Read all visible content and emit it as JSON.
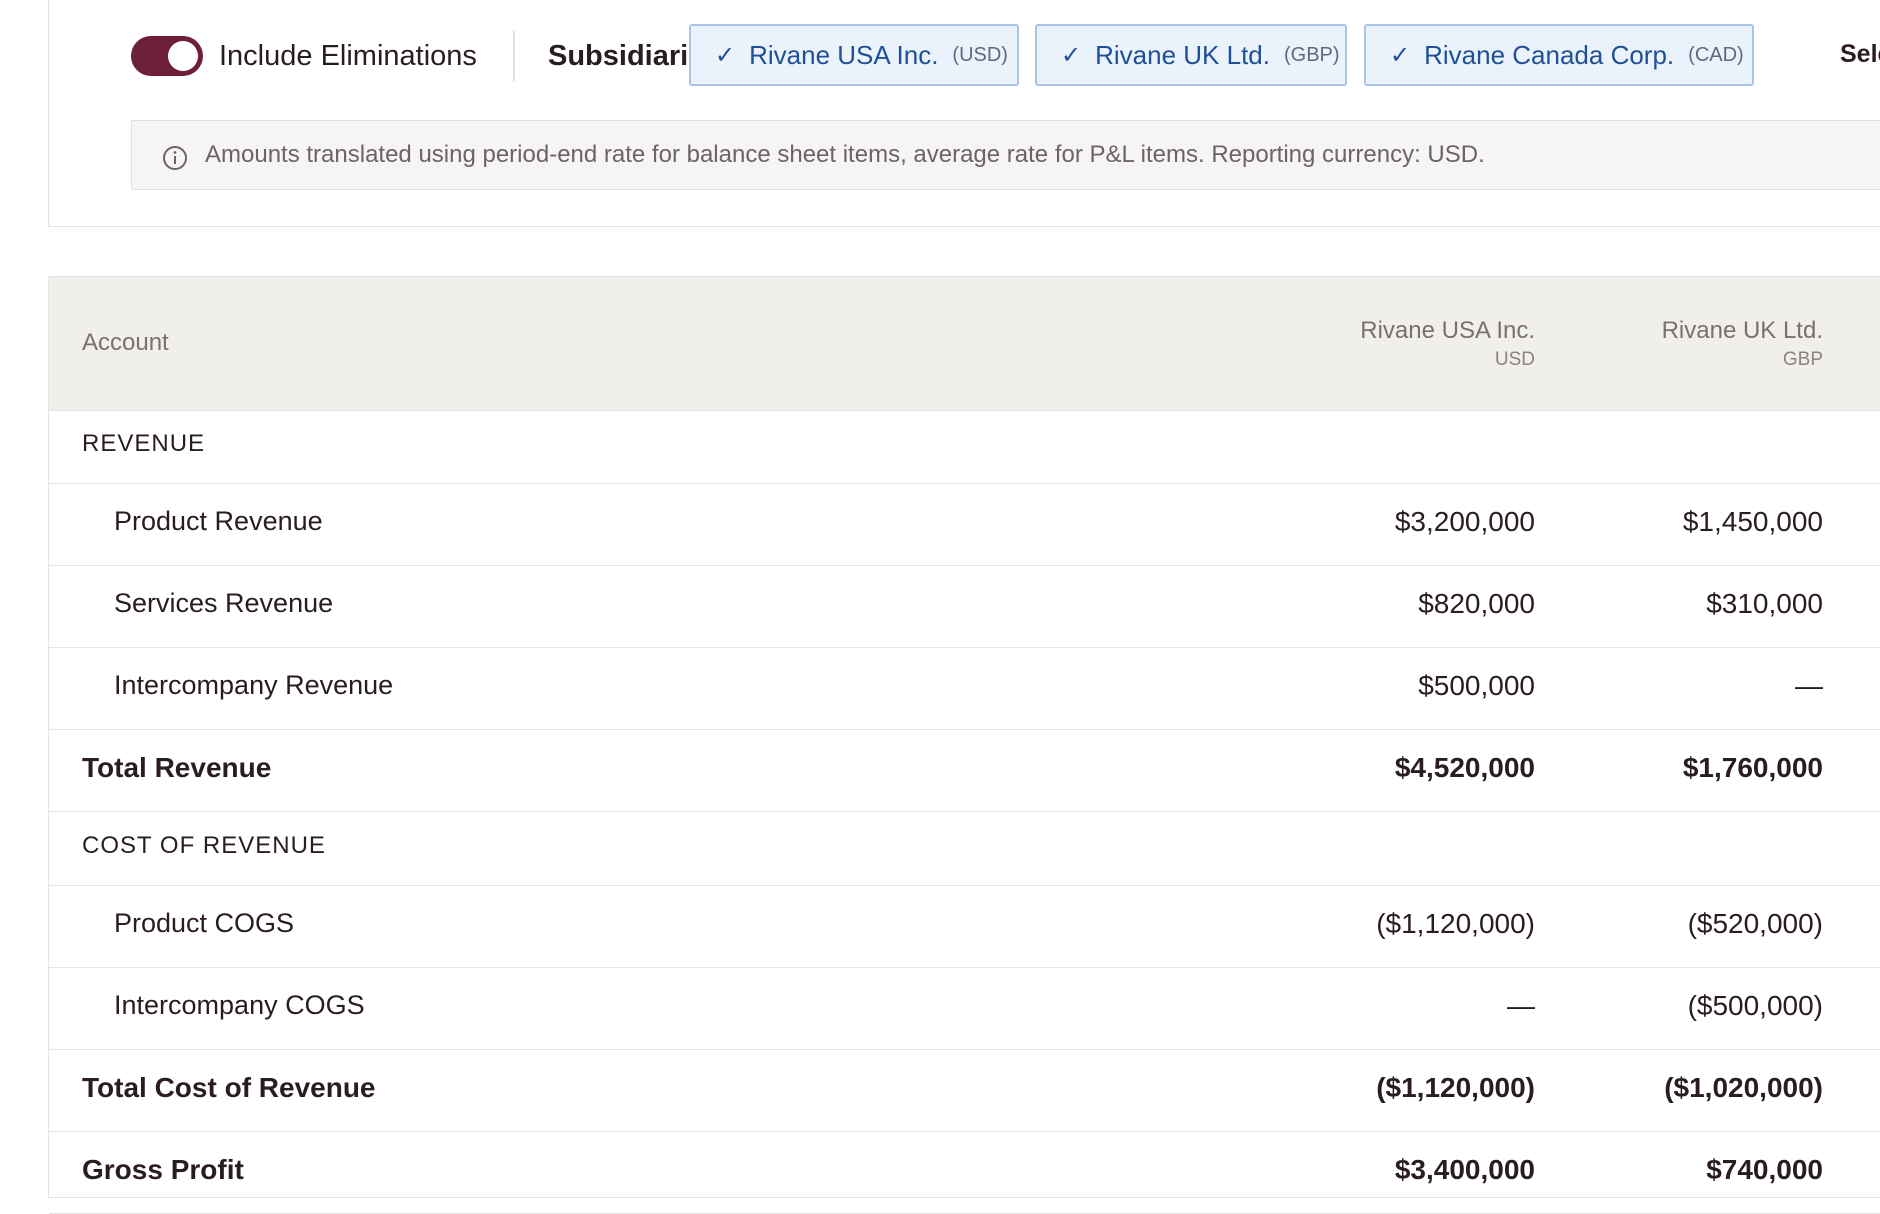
{
  "filters": {
    "include_eliminations_label": "Include Eliminations",
    "include_eliminations_on": true,
    "subsidiaries_label": "Subsidiaries:",
    "chips": [
      {
        "name": "Rivane USA Inc.",
        "currency": "(USD)",
        "selected": true
      },
      {
        "name": "Rivane UK Ltd.",
        "currency": "(GBP)",
        "selected": true
      },
      {
        "name": "Rivane Canada Corp.",
        "currency": "(CAD)",
        "selected": true
      }
    ],
    "select_all_label": "Select A",
    "check_glyph": "✓",
    "info_text": "Amounts translated using period-end rate for balance sheet items, average rate for P&L items. Reporting currency: USD."
  },
  "table": {
    "header": {
      "account": "Account",
      "columns": [
        {
          "name": "Rivane USA Inc.",
          "currency": "USD"
        },
        {
          "name": "Rivane UK Ltd.",
          "currency": "GBP"
        }
      ]
    },
    "rows": [
      {
        "type": "section",
        "label": "REVENUE",
        "values": [
          "",
          ""
        ]
      },
      {
        "type": "line",
        "label": "Product Revenue",
        "values": [
          "$3,200,000",
          "$1,450,000"
        ]
      },
      {
        "type": "line",
        "label": "Services Revenue",
        "values": [
          "$820,000",
          "$310,000"
        ]
      },
      {
        "type": "line",
        "label": "Intercompany Revenue",
        "values": [
          "$500,000",
          "—"
        ]
      },
      {
        "type": "total",
        "label": "Total Revenue",
        "values": [
          "$4,520,000",
          "$1,760,000"
        ]
      },
      {
        "type": "section",
        "label": "COST OF REVENUE",
        "values": [
          "",
          ""
        ]
      },
      {
        "type": "line",
        "label": "Product COGS",
        "values": [
          "($1,120,000)",
          "($520,000)"
        ]
      },
      {
        "type": "line",
        "label": "Intercompany COGS",
        "values": [
          "—",
          "($500,000)"
        ]
      },
      {
        "type": "total",
        "label": "Total Cost of Revenue",
        "values": [
          "($1,120,000)",
          "($1,020,000)"
        ]
      },
      {
        "type": "total",
        "label": "Gross Profit",
        "values": [
          "$3,400,000",
          "$740,000"
        ]
      }
    ]
  },
  "colors": {
    "brand": "#6d1f3c",
    "chip_bg": "#eaf2fc",
    "chip_border": "#a9c4e6",
    "chip_text": "#1f4f96",
    "header_bg": "#f1efec"
  }
}
